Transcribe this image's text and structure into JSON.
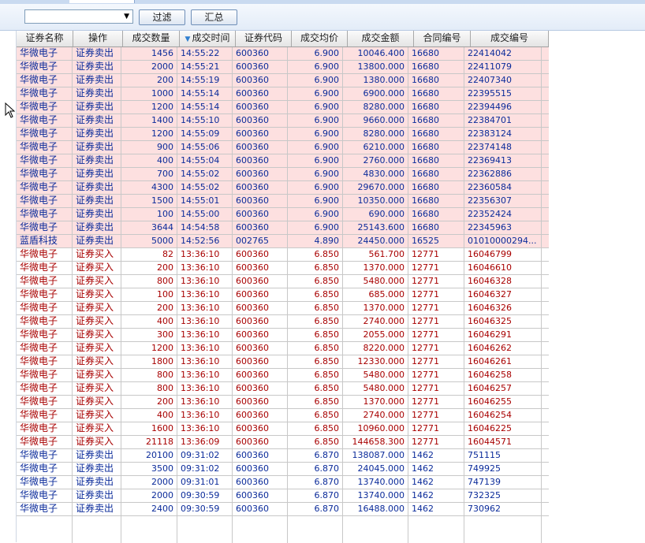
{
  "toolbar": {
    "combo_value": "",
    "filter_label": "过滤",
    "summary_label": "汇总"
  },
  "icons": {
    "dropdown": "chevron-down-icon",
    "cursor": "mouse-pointer-icon",
    "sort": "sort-desc-icon"
  },
  "colors": {
    "sell_bg": "#fde0e0",
    "sell_text": "#0b2b9a",
    "buy_text": "#a80000"
  },
  "table": {
    "columns": [
      "证券名称",
      "操作",
      "成交数量",
      "成交时间",
      "证券代码",
      "成交均价",
      "成交金额",
      "合同编号",
      "成交编号"
    ],
    "sorted_column": "成交时间",
    "rows": [
      {
        "style": "sell",
        "cells": [
          "华微电子",
          "证券卖出",
          "1456",
          "14:55:22",
          "600360",
          "6.900",
          "10046.400",
          "16680",
          "22414042"
        ]
      },
      {
        "style": "sell",
        "cells": [
          "华微电子",
          "证券卖出",
          "2000",
          "14:55:21",
          "600360",
          "6.900",
          "13800.000",
          "16680",
          "22411079"
        ]
      },
      {
        "style": "sell",
        "cells": [
          "华微电子",
          "证券卖出",
          "200",
          "14:55:19",
          "600360",
          "6.900",
          "1380.000",
          "16680",
          "22407340"
        ]
      },
      {
        "style": "sell",
        "cells": [
          "华微电子",
          "证券卖出",
          "1000",
          "14:55:14",
          "600360",
          "6.900",
          "6900.000",
          "16680",
          "22395515"
        ]
      },
      {
        "style": "sell",
        "cells": [
          "华微电子",
          "证券卖出",
          "1200",
          "14:55:14",
          "600360",
          "6.900",
          "8280.000",
          "16680",
          "22394496"
        ]
      },
      {
        "style": "sell",
        "cells": [
          "华微电子",
          "证券卖出",
          "1400",
          "14:55:10",
          "600360",
          "6.900",
          "9660.000",
          "16680",
          "22384701"
        ]
      },
      {
        "style": "sell",
        "cells": [
          "华微电子",
          "证券卖出",
          "1200",
          "14:55:09",
          "600360",
          "6.900",
          "8280.000",
          "16680",
          "22383124"
        ]
      },
      {
        "style": "sell",
        "cells": [
          "华微电子",
          "证券卖出",
          "900",
          "14:55:06",
          "600360",
          "6.900",
          "6210.000",
          "16680",
          "22374148"
        ]
      },
      {
        "style": "sell",
        "cells": [
          "华微电子",
          "证券卖出",
          "400",
          "14:55:04",
          "600360",
          "6.900",
          "2760.000",
          "16680",
          "22369413"
        ]
      },
      {
        "style": "sell",
        "cells": [
          "华微电子",
          "证券卖出",
          "700",
          "14:55:02",
          "600360",
          "6.900",
          "4830.000",
          "16680",
          "22362886"
        ]
      },
      {
        "style": "sell",
        "cells": [
          "华微电子",
          "证券卖出",
          "4300",
          "14:55:02",
          "600360",
          "6.900",
          "29670.000",
          "16680",
          "22360584"
        ]
      },
      {
        "style": "sell",
        "cells": [
          "华微电子",
          "证券卖出",
          "1500",
          "14:55:01",
          "600360",
          "6.900",
          "10350.000",
          "16680",
          "22356307"
        ]
      },
      {
        "style": "sell",
        "cells": [
          "华微电子",
          "证券卖出",
          "100",
          "14:55:00",
          "600360",
          "6.900",
          "690.000",
          "16680",
          "22352424"
        ]
      },
      {
        "style": "sell",
        "cells": [
          "华微电子",
          "证券卖出",
          "3644",
          "14:54:58",
          "600360",
          "6.900",
          "25143.600",
          "16680",
          "22345963"
        ]
      },
      {
        "style": "sell",
        "cells": [
          "蓝盾科技",
          "证券卖出",
          "5000",
          "14:52:56",
          "002765",
          "4.890",
          "24450.000",
          "16525",
          "01010000294..."
        ]
      },
      {
        "style": "buy",
        "cells": [
          "华微电子",
          "证券买入",
          "82",
          "13:36:10",
          "600360",
          "6.850",
          "561.700",
          "12771",
          "16046799"
        ]
      },
      {
        "style": "buy",
        "cells": [
          "华微电子",
          "证券买入",
          "200",
          "13:36:10",
          "600360",
          "6.850",
          "1370.000",
          "12771",
          "16046610"
        ]
      },
      {
        "style": "buy",
        "cells": [
          "华微电子",
          "证券买入",
          "800",
          "13:36:10",
          "600360",
          "6.850",
          "5480.000",
          "12771",
          "16046328"
        ]
      },
      {
        "style": "buy",
        "cells": [
          "华微电子",
          "证券买入",
          "100",
          "13:36:10",
          "600360",
          "6.850",
          "685.000",
          "12771",
          "16046327"
        ]
      },
      {
        "style": "buy",
        "cells": [
          "华微电子",
          "证券买入",
          "200",
          "13:36:10",
          "600360",
          "6.850",
          "1370.000",
          "12771",
          "16046326"
        ]
      },
      {
        "style": "buy",
        "cells": [
          "华微电子",
          "证券买入",
          "400",
          "13:36:10",
          "600360",
          "6.850",
          "2740.000",
          "12771",
          "16046325"
        ]
      },
      {
        "style": "buy",
        "cells": [
          "华微电子",
          "证券买入",
          "300",
          "13:36:10",
          "600360",
          "6.850",
          "2055.000",
          "12771",
          "16046291"
        ]
      },
      {
        "style": "buy",
        "cells": [
          "华微电子",
          "证券买入",
          "1200",
          "13:36:10",
          "600360",
          "6.850",
          "8220.000",
          "12771",
          "16046262"
        ]
      },
      {
        "style": "buy",
        "cells": [
          "华微电子",
          "证券买入",
          "1800",
          "13:36:10",
          "600360",
          "6.850",
          "12330.000",
          "12771",
          "16046261"
        ]
      },
      {
        "style": "buy",
        "cells": [
          "华微电子",
          "证券买入",
          "800",
          "13:36:10",
          "600360",
          "6.850",
          "5480.000",
          "12771",
          "16046258"
        ]
      },
      {
        "style": "buy",
        "cells": [
          "华微电子",
          "证券买入",
          "800",
          "13:36:10",
          "600360",
          "6.850",
          "5480.000",
          "12771",
          "16046257"
        ]
      },
      {
        "style": "buy",
        "cells": [
          "华微电子",
          "证券买入",
          "200",
          "13:36:10",
          "600360",
          "6.850",
          "1370.000",
          "12771",
          "16046255"
        ]
      },
      {
        "style": "buy",
        "cells": [
          "华微电子",
          "证券买入",
          "400",
          "13:36:10",
          "600360",
          "6.850",
          "2740.000",
          "12771",
          "16046254"
        ]
      },
      {
        "style": "buy",
        "cells": [
          "华微电子",
          "证券买入",
          "1600",
          "13:36:10",
          "600360",
          "6.850",
          "10960.000",
          "12771",
          "16046225"
        ]
      },
      {
        "style": "buy",
        "cells": [
          "华微电子",
          "证券买入",
          "21118",
          "13:36:09",
          "600360",
          "6.850",
          "144658.300",
          "12771",
          "16044571"
        ]
      },
      {
        "style": "sell2",
        "cells": [
          "华微电子",
          "证券卖出",
          "20100",
          "09:31:02",
          "600360",
          "6.870",
          "138087.000",
          "1462",
          "751115"
        ]
      },
      {
        "style": "sell2",
        "cells": [
          "华微电子",
          "证券卖出",
          "3500",
          "09:31:02",
          "600360",
          "6.870",
          "24045.000",
          "1462",
          "749925"
        ]
      },
      {
        "style": "sell2",
        "cells": [
          "华微电子",
          "证券卖出",
          "2000",
          "09:31:01",
          "600360",
          "6.870",
          "13740.000",
          "1462",
          "747139"
        ]
      },
      {
        "style": "sell2",
        "cells": [
          "华微电子",
          "证券卖出",
          "2000",
          "09:30:59",
          "600360",
          "6.870",
          "13740.000",
          "1462",
          "732325"
        ]
      },
      {
        "style": "sell2",
        "cells": [
          "华微电子",
          "证券卖出",
          "2400",
          "09:30:59",
          "600360",
          "6.870",
          "16488.000",
          "1462",
          "730962"
        ]
      }
    ]
  }
}
